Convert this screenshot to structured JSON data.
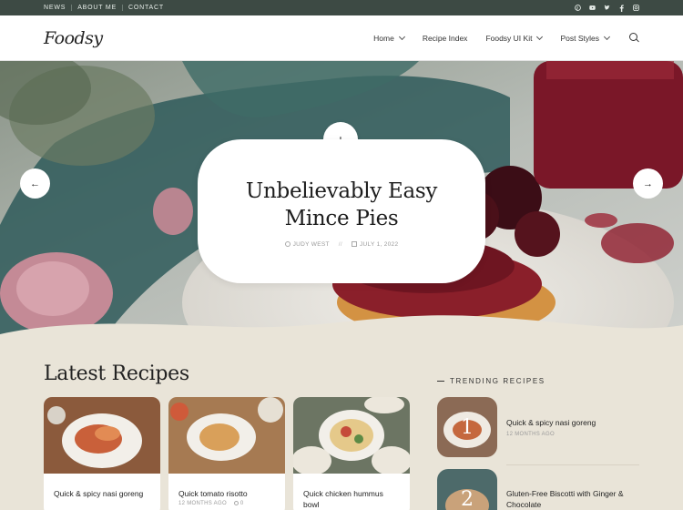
{
  "topbar": {
    "links": [
      "NEWS",
      "ABOUT ME",
      "CONTACT"
    ],
    "social_icons": [
      "pinterest-icon",
      "youtube-icon",
      "twitter-icon",
      "facebook-icon",
      "instagram-icon"
    ]
  },
  "header": {
    "logo": "Foodsy",
    "nav": [
      {
        "label": "Home",
        "has_dropdown": true
      },
      {
        "label": "Recipe Index",
        "has_dropdown": false
      },
      {
        "label": "Foodsy UI Kit",
        "has_dropdown": true
      },
      {
        "label": "Post Styles",
        "has_dropdown": true
      }
    ],
    "search_icon": "search-icon"
  },
  "hero": {
    "title_line1": "Unbelievably Easy",
    "title_line2": "Mince Pies",
    "author": "JUDY WEST",
    "date": "JULY 1, 2022",
    "plus_label": "+",
    "prev_label": "←",
    "next_label": "→"
  },
  "latest": {
    "heading": "Latest Recipes",
    "cards": [
      {
        "title": "Quick & spicy nasi goreng",
        "meta": ""
      },
      {
        "title": "Quick tomato risotto",
        "meta": "12 MONTHS AGO"
      },
      {
        "title": "Quick chicken hummus bowl",
        "meta": ""
      }
    ],
    "comments_count": "0"
  },
  "trending": {
    "heading": "TRENDING RECIPES",
    "items": [
      {
        "num": "1",
        "title": "Quick & spicy nasi goreng",
        "meta": "12 MONTHS AGO"
      },
      {
        "num": "2",
        "title": "Gluten-Free Biscotti with Ginger & Chocolate",
        "meta": ""
      }
    ]
  },
  "colors": {
    "topbar_bg": "#3d4a44",
    "page_bg": "#e9e4d8"
  }
}
